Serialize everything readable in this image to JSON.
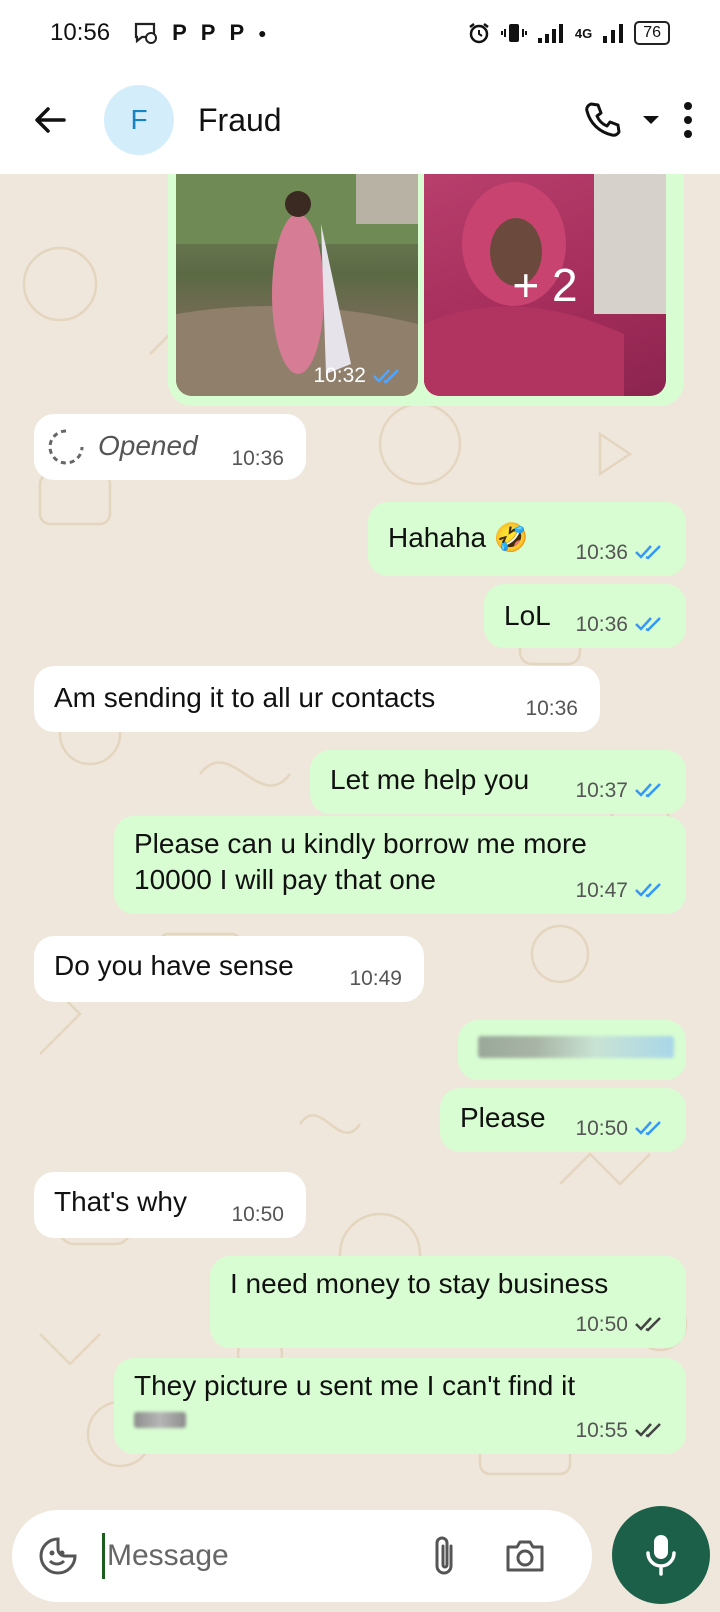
{
  "status_bar": {
    "time": "10:56",
    "left_icons": [
      "whatsapp-icon",
      "p-icon",
      "p-icon",
      "p-icon",
      "dot-icon"
    ],
    "network_label": "4G",
    "battery": "76"
  },
  "header": {
    "avatar_letter": "F",
    "contact_name": "Fraud"
  },
  "album": {
    "first_image_time": "10:32",
    "extra_count": "+ 2"
  },
  "messages": [
    {
      "dir": "in",
      "text": "Opened",
      "time": "10:36",
      "type": "view-once"
    },
    {
      "dir": "out",
      "text": "Hahaha 🤣",
      "time": "10:36",
      "status": "read"
    },
    {
      "dir": "out",
      "text": "LoL",
      "time": "10:36",
      "status": "read"
    },
    {
      "dir": "in",
      "text": "Am sending it to all ur contacts",
      "time": "10:36"
    },
    {
      "dir": "out",
      "text": "Let me help you",
      "time": "10:37",
      "status": "read"
    },
    {
      "dir": "out",
      "text": "Please can u kindly borrow me more 10000 I will pay that one",
      "time": "10:47",
      "status": "read"
    },
    {
      "dir": "in",
      "text": "Do you have sense",
      "time": "10:49"
    },
    {
      "dir": "out",
      "text": "",
      "time": "",
      "type": "redacted"
    },
    {
      "dir": "out",
      "text": "Please",
      "time": "10:50",
      "status": "read"
    },
    {
      "dir": "in",
      "text": "That's why",
      "time": "10:50"
    },
    {
      "dir": "out",
      "text": "I need money to stay business",
      "time": "10:50",
      "status": "delivered"
    },
    {
      "dir": "out",
      "text": "They picture u sent me I can't find it",
      "time": "10:55",
      "status": "delivered"
    }
  ],
  "composer": {
    "placeholder": "Message"
  },
  "colors": {
    "outgoing": "#d8fdd2",
    "incoming": "#ffffff",
    "read_tick": "#3497f9",
    "mic_button": "#1d6049",
    "avatar_bg": "#d3eefa"
  }
}
